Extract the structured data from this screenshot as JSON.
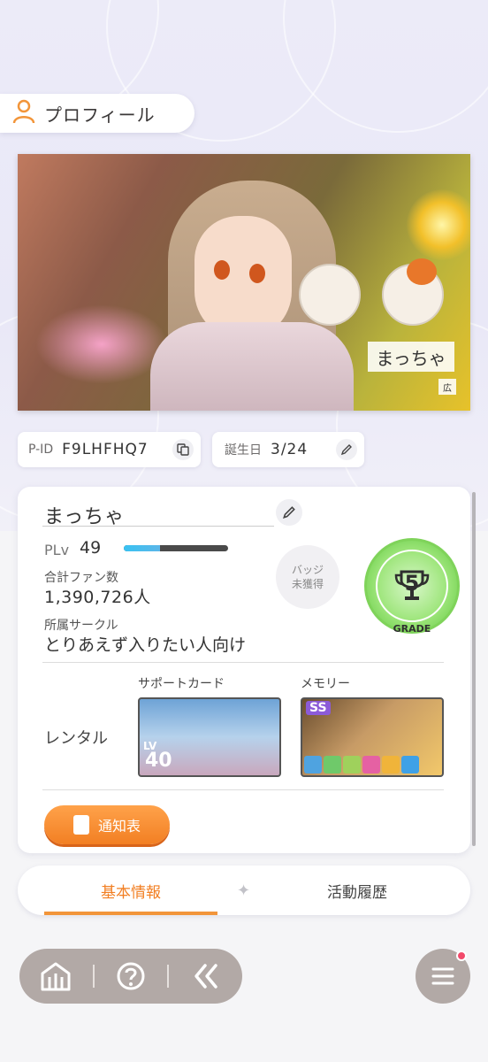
{
  "header": {
    "title": "プロフィール",
    "icon": "person-icon"
  },
  "banner": {
    "name_plate": "まっちゃ",
    "ad_tag": "広"
  },
  "player_id": {
    "label": "P-ID",
    "value": "F9LHFHQ7"
  },
  "birthday": {
    "label": "誕生日",
    "value": "3/24"
  },
  "profile": {
    "username": "まっちゃ",
    "plv_label": "PLv",
    "plv_value": "49",
    "plv_progress": 0.35,
    "fans_label": "合計ファン数",
    "fans_value": "1,390,726人",
    "circle_label": "所属サークル",
    "circle_value": "とりあえず入りたい人向け",
    "badge_line1": "バッジ",
    "badge_line2": "未獲得",
    "grade_number": "5",
    "grade_label": "GRADE"
  },
  "rental": {
    "label": "レンタル",
    "support_label": "サポートカード",
    "memory_label": "メモリー",
    "support_lv_prefix": "LV",
    "support_lv": "40",
    "memory_rank": "SS"
  },
  "report_button": {
    "label": "通知表"
  },
  "tabs": [
    {
      "label": "基本情報",
      "active": true
    },
    {
      "label": "活動履歴",
      "active": false
    }
  ],
  "colors": {
    "accent": "#f27f23",
    "grade": "#7fd35a",
    "nav": "#b2a9a6"
  }
}
